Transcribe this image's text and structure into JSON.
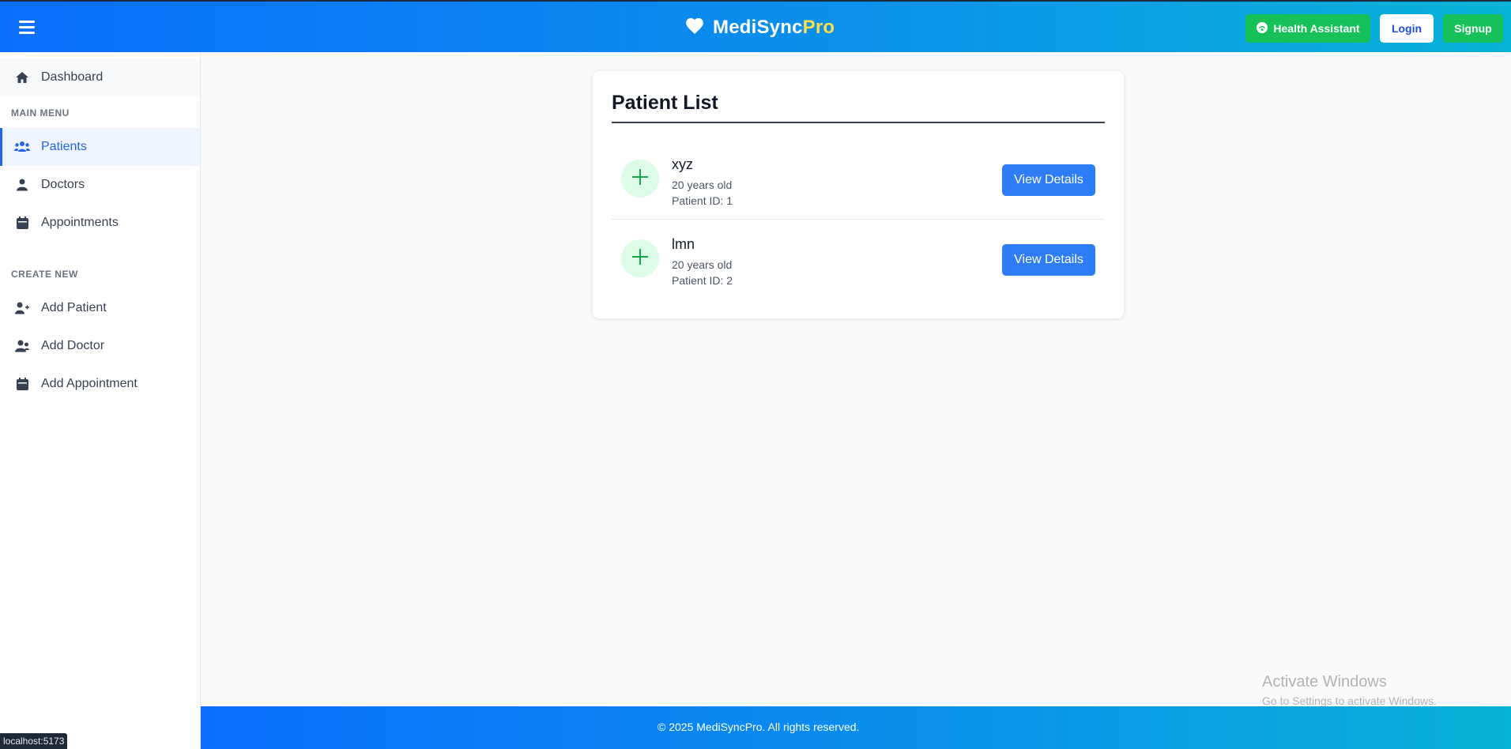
{
  "header": {
    "brand_main": "MediSync",
    "brand_accent": "Pro",
    "health_assistant_label": "Health Assistant",
    "login_label": "Login",
    "signup_label": "Signup"
  },
  "sidebar": {
    "dashboard": "Dashboard",
    "main_menu_heading": "MAIN MENU",
    "main_items": [
      {
        "label": "Patients",
        "icon": "users-icon",
        "active": true
      },
      {
        "label": "Doctors",
        "icon": "user-icon"
      },
      {
        "label": "Appointments",
        "icon": "calendar-icon"
      }
    ],
    "create_new_heading": "CREATE NEW",
    "create_items": [
      {
        "label": "Add Patient",
        "icon": "user-plus-icon"
      },
      {
        "label": "Add Doctor",
        "icon": "user-doctor-icon"
      },
      {
        "label": "Add Appointment",
        "icon": "calendar-icon"
      }
    ]
  },
  "main": {
    "title": "Patient List",
    "patients": [
      {
        "name": "xyz",
        "age": "20 years old",
        "patient_id": "Patient ID: 1",
        "button": "View Details"
      },
      {
        "name": "lmn",
        "age": "20 years old",
        "patient_id": "Patient ID: 2",
        "button": "View Details"
      }
    ]
  },
  "footer": {
    "copyright": "© 2025 MediSyncPro. All rights reserved."
  },
  "watermark": {
    "title": "Activate Windows",
    "subtitle": "Go to Settings to activate Windows."
  },
  "status_bar": {
    "url": "localhost:5173"
  },
  "colors": {
    "primary": "#0d6efd",
    "accent_green": "#16c15a",
    "brand_accent": "#fde047",
    "button_blue": "#2f7df6"
  }
}
